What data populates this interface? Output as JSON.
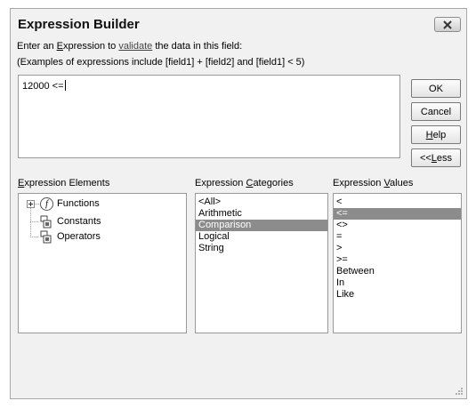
{
  "dialog": {
    "title": "Expression Builder",
    "intro": {
      "part1": "Enter an ",
      "expression_access_key": "E",
      "part2": "xpression to ",
      "validate_link": "validate",
      "part3": " the data in this field:"
    },
    "examples": "(Examples of expressions include [field1] + [field2] and [field1] < 5)",
    "expression_value": "12000 <="
  },
  "buttons": {
    "ok": "OK",
    "cancel": "Cancel",
    "help_key": "H",
    "help_rest": "elp",
    "less_pre": "<< ",
    "less_key": "L",
    "less_rest": "ess"
  },
  "elements": {
    "label_key": "E",
    "label_rest": "xpression Elements",
    "tree": [
      {
        "label": "Functions",
        "icon": "function-icon",
        "expandable": true
      },
      {
        "label": "Constants",
        "icon": "folder-icon",
        "expandable": false
      },
      {
        "label": "Operators",
        "icon": "folder-icon",
        "expandable": false
      }
    ]
  },
  "categories": {
    "label_pre": "Expression ",
    "label_key": "C",
    "label_rest": "ategories",
    "items": [
      "<All>",
      "Arithmetic",
      "Comparison",
      "Logical",
      "String"
    ],
    "selected_index": 2
  },
  "values": {
    "label_pre": "Expression ",
    "label_key": "V",
    "label_rest": "alues",
    "items": [
      "<",
      "<=",
      "<>",
      "=",
      ">",
      ">=",
      "Between",
      "In",
      "Like"
    ],
    "selected_index": 1
  },
  "colors": {
    "selection": "#8c8c8c",
    "dialog_bg": "#f1f1f1",
    "border": "#9a9a9a"
  }
}
